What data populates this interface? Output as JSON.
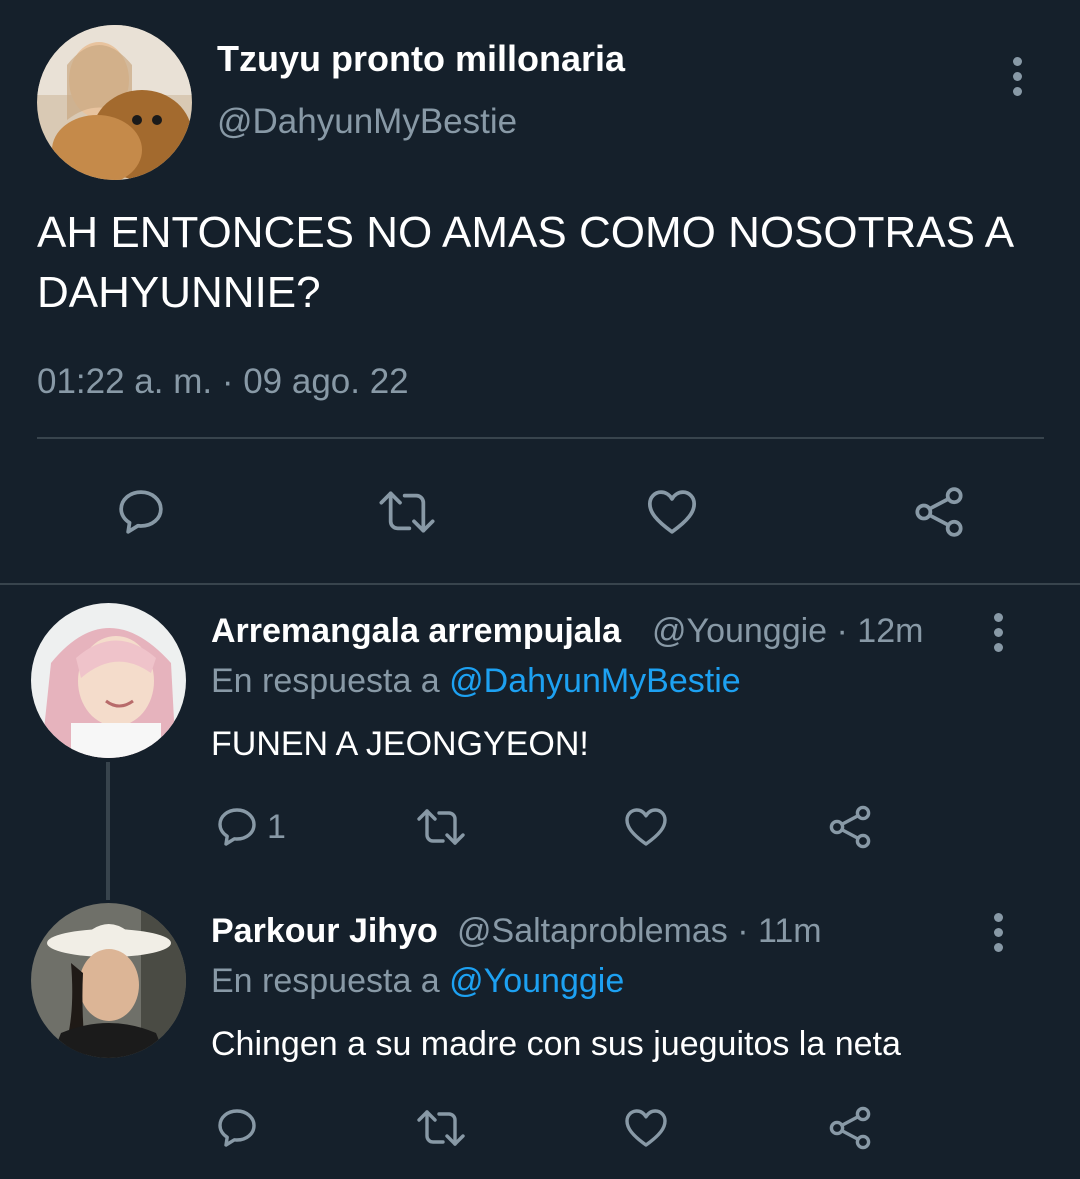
{
  "main_tweet": {
    "display_name": "Tzuyu pronto millonaria",
    "handle": "@DahyunMyBestie",
    "text": "AH ENTONCES NO AMAS COMO NOSOTRAS A DAHYUNNIE?",
    "timestamp": "01:22 a. m. · 09 ago. 22"
  },
  "replies": [
    {
      "display_name": "Arremangala arrempujala",
      "handle_time": "@Younggie · 12m",
      "reply_label": "En respuesta a",
      "reply_to": "@DahyunMyBestie",
      "text": "FUNEN A JEONGYEON!",
      "reply_count": "1"
    },
    {
      "display_name": "Parkour Jihyo",
      "handle_time": "@Saltaproblemas · 11m",
      "reply_label": "En respuesta a",
      "reply_to": "@Younggie",
      "text": "Chingen a su madre con sus jueguitos la neta"
    }
  ],
  "colors": {
    "background": "#15202b",
    "secondary_text": "#8899a6",
    "link": "#1da1f2",
    "divider": "#38444d"
  },
  "icons": [
    "reply-icon",
    "retweet-icon",
    "like-icon",
    "share-icon",
    "more-vertical-icon"
  ]
}
